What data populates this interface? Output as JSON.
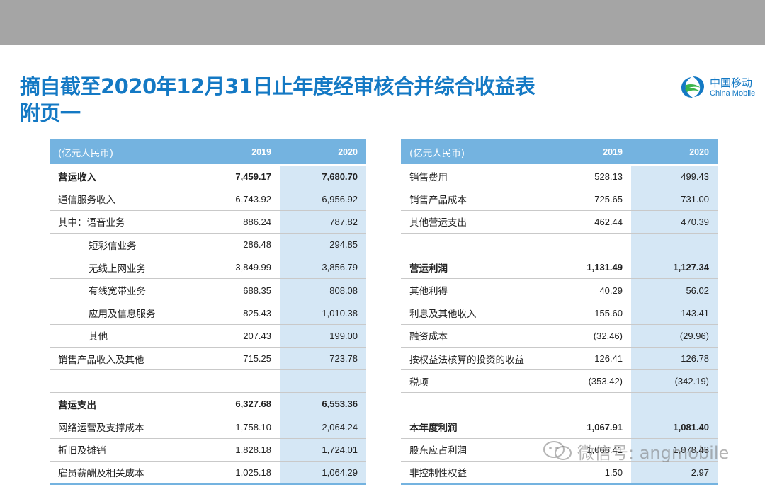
{
  "title_line1": "摘自截至2020年12月31日止年度经审核合并综合收益表",
  "title_line2": "附页一",
  "logo": {
    "cn": "中国移动",
    "en": "China Mobile",
    "icon": "china-mobile-logo-icon"
  },
  "colors": {
    "title": "#1479c4",
    "header": "#74b3e0",
    "highlight": "#d5e7f5",
    "top_band": "#a5a5a5"
  },
  "left_table": {
    "headers": [
      "(亿元人民币)",
      "2019",
      "2020"
    ],
    "rows": [
      {
        "label": "营运收入",
        "v2019": "7,459.17",
        "v2020": "7,680.70",
        "bold": true,
        "indent": false
      },
      {
        "label": "通信服务收入",
        "v2019": "6,743.92",
        "v2020": "6,956.92",
        "bold": false,
        "indent": false
      },
      {
        "label": "其中：语音业务",
        "v2019": "886.24",
        "v2020": "787.82",
        "bold": false,
        "indent": false
      },
      {
        "label": "短彩信业务",
        "v2019": "286.48",
        "v2020": "294.85",
        "bold": false,
        "indent": true
      },
      {
        "label": "无线上网业务",
        "v2019": "3,849.99",
        "v2020": "3,856.79",
        "bold": false,
        "indent": true
      },
      {
        "label": "有线宽带业务",
        "v2019": "688.35",
        "v2020": "808.08",
        "bold": false,
        "indent": true
      },
      {
        "label": "应用及信息服务",
        "v2019": "825.43",
        "v2020": "1,010.38",
        "bold": false,
        "indent": true
      },
      {
        "label": "其他",
        "v2019": "207.43",
        "v2020": "199.00",
        "bold": false,
        "indent": true
      },
      {
        "label": "销售产品收入及其他",
        "v2019": "715.25",
        "v2020": "723.78",
        "bold": false,
        "indent": false
      },
      {
        "label": "",
        "v2019": "",
        "v2020": "",
        "bold": false,
        "indent": false
      },
      {
        "label": "营运支出",
        "v2019": "6,327.68",
        "v2020": "6,553.36",
        "bold": true,
        "indent": false
      },
      {
        "label": "网络运营及支撑成本",
        "v2019": "1,758.10",
        "v2020": "2,064.24",
        "bold": false,
        "indent": false
      },
      {
        "label": "折旧及摊销",
        "v2019": "1,828.18",
        "v2020": "1,724.01",
        "bold": false,
        "indent": false
      },
      {
        "label": "雇员薪酬及相关成本",
        "v2019": "1,025.18",
        "v2020": "1,064.29",
        "bold": false,
        "indent": false
      }
    ]
  },
  "right_table": {
    "headers": [
      "(亿元人民币)",
      "2019",
      "2020"
    ],
    "rows": [
      {
        "label": "销售费用",
        "v2019": "528.13",
        "v2020": "499.43",
        "bold": false,
        "indent": false
      },
      {
        "label": "销售产品成本",
        "v2019": "725.65",
        "v2020": "731.00",
        "bold": false,
        "indent": false
      },
      {
        "label": "其他营运支出",
        "v2019": "462.44",
        "v2020": "470.39",
        "bold": false,
        "indent": false
      },
      {
        "label": "",
        "v2019": "",
        "v2020": "",
        "bold": false,
        "indent": false
      },
      {
        "label": "营运利润",
        "v2019": "1,131.49",
        "v2020": "1,127.34",
        "bold": true,
        "indent": false
      },
      {
        "label": "其他利得",
        "v2019": "40.29",
        "v2020": "56.02",
        "bold": false,
        "indent": false
      },
      {
        "label": "利息及其他收入",
        "v2019": "155.60",
        "v2020": "143.41",
        "bold": false,
        "indent": false
      },
      {
        "label": "融资成本",
        "v2019": "(32.46)",
        "v2020": "(29.96)",
        "bold": false,
        "indent": false
      },
      {
        "label": "按权益法核算的投资的收益",
        "v2019": "126.41",
        "v2020": "126.78",
        "bold": false,
        "indent": false
      },
      {
        "label": "税项",
        "v2019": "(353.42)",
        "v2020": "(342.19)",
        "bold": false,
        "indent": false
      },
      {
        "label": "",
        "v2019": "",
        "v2020": "",
        "bold": false,
        "indent": false
      },
      {
        "label": "本年度利润",
        "v2019": "1,067.91",
        "v2020": "1,081.40",
        "bold": true,
        "indent": false
      },
      {
        "label": "股东应占利润",
        "v2019": "1,066.41",
        "v2020": "1,078.43",
        "bold": false,
        "indent": false
      },
      {
        "label": "非控制性权益",
        "v2019": "1.50",
        "v2020": "2.97",
        "bold": false,
        "indent": false
      }
    ]
  },
  "watermark": {
    "icon": "wechat-icon",
    "text": "微信号: angmobile"
  }
}
